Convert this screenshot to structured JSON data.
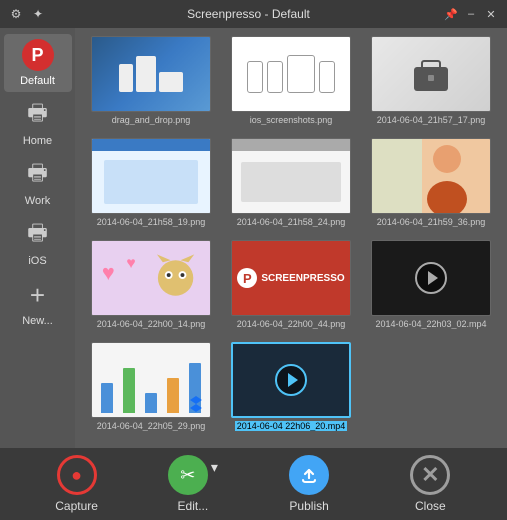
{
  "titleBar": {
    "title": "Screenpresso  -  Default",
    "controls": [
      "pin",
      "minimize",
      "close"
    ]
  },
  "sidebar": {
    "items": [
      {
        "id": "default",
        "label": "Default",
        "icon": "default-icon",
        "active": true
      },
      {
        "id": "home",
        "label": "Home",
        "icon": "printer-icon"
      },
      {
        "id": "work",
        "label": "Work",
        "icon": "printer-icon"
      },
      {
        "id": "ios",
        "label": "iOS",
        "icon": "printer-icon"
      },
      {
        "id": "new",
        "label": "New...",
        "icon": "plus-icon"
      }
    ]
  },
  "grid": {
    "items": [
      {
        "id": 1,
        "label": "drag_and_drop.png",
        "type": "drag-drop",
        "selected": false
      },
      {
        "id": 2,
        "label": "ios_screenshots.png",
        "type": "ios",
        "selected": false
      },
      {
        "id": 3,
        "label": "2014-06-04_21h57_17.png",
        "type": "suitcase",
        "selected": false
      },
      {
        "id": 4,
        "label": "2014-06-04_21h58_19.png",
        "type": "screenshot-blue",
        "selected": false
      },
      {
        "id": 5,
        "label": "2014-06-04_21h58_24.png",
        "type": "screenshot-light",
        "selected": false
      },
      {
        "id": 6,
        "label": "2014-06-04_21h59_36.png",
        "type": "person",
        "selected": false
      },
      {
        "id": 7,
        "label": "2014-06-04_22h00_14.png",
        "type": "cat",
        "selected": false
      },
      {
        "id": 8,
        "label": "2014-06-04_22h00_44.png",
        "type": "screenpresso",
        "selected": false
      },
      {
        "id": 9,
        "label": "2014-06-04_22h03_02.mp4",
        "type": "video",
        "selected": false
      },
      {
        "id": 10,
        "label": "2014-06-04_22h05_29.png",
        "type": "chart",
        "selected": false
      },
      {
        "id": 11,
        "label": "2014-06-04 22h06_20.mp4",
        "type": "video2",
        "selected": true
      }
    ]
  },
  "toolbar": {
    "capture_label": "Capture",
    "edit_label": "Edit...",
    "publish_label": "Publish",
    "close_label": "Close"
  }
}
